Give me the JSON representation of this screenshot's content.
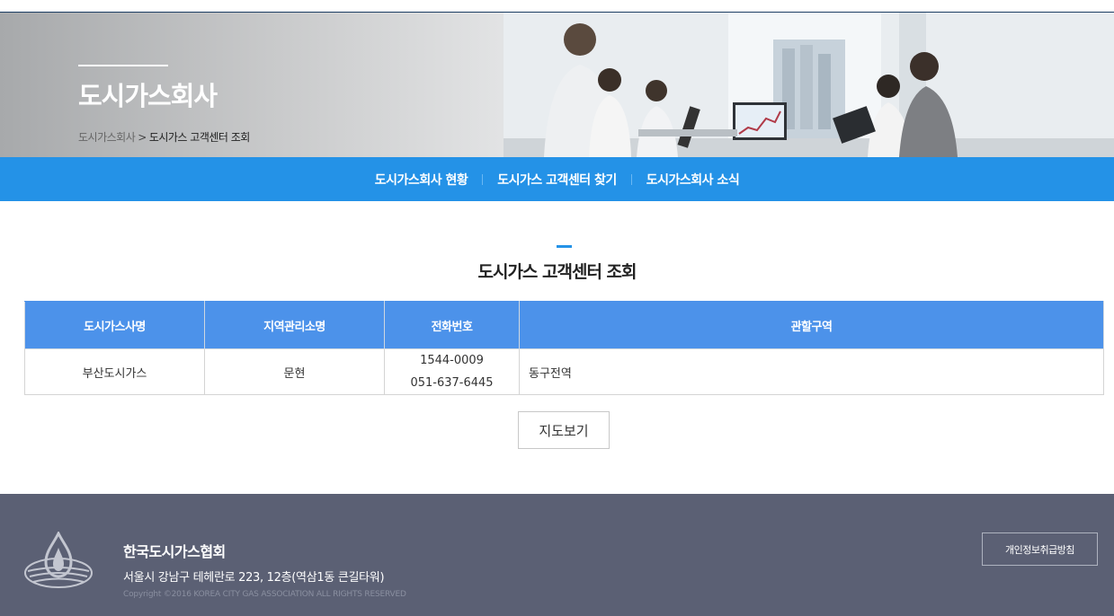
{
  "hero": {
    "title": "도시가스회사",
    "breadcrumb": {
      "parent": "도시가스회사",
      "separator": ">",
      "current": "도시가스 고객센터 조회"
    }
  },
  "subnav": {
    "items": [
      "도시가스회사 현황",
      "도시가스 고객센터 찾기",
      "도시가스회사 소식"
    ]
  },
  "section": {
    "title": "도시가스 고객센터 조회"
  },
  "table": {
    "headers": [
      "도시가스사명",
      "지역관리소명",
      "전화번호",
      "관할구역"
    ],
    "rows": [
      {
        "company": "부산도시가스",
        "office": "문현",
        "phone1": "1544-0009",
        "phone2": "051-637-6445",
        "area": "동구전역"
      }
    ]
  },
  "map_button": "지도보기",
  "footer": {
    "org": "한국도시가스협회",
    "address": "서울시 강남구 테헤란로 223, 12층(역삼1동 큰길타워)",
    "copyright": "Copyright ©2016 KOREA CITY GAS ASSOCIATION ALL RIGHTS RESERVED",
    "privacy_button": "개인정보취급방침"
  },
  "colors": {
    "accent": "#2492e7",
    "table_header": "#4c92ea",
    "footer_bg": "#5b6074"
  }
}
